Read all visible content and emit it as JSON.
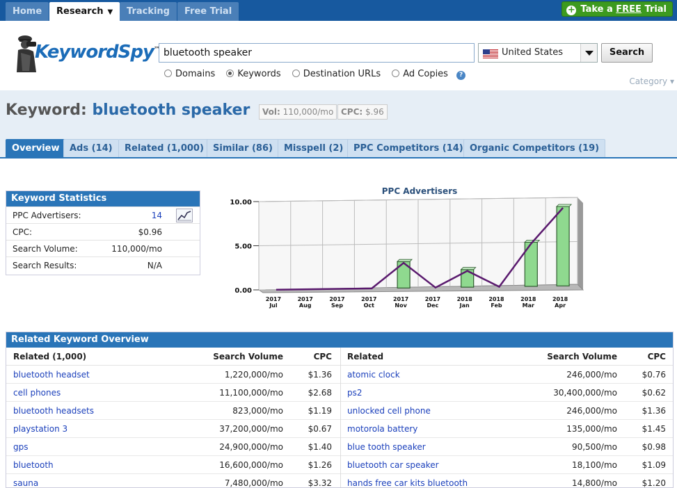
{
  "nav": {
    "tabs": [
      {
        "label": "Home"
      },
      {
        "label": "Research"
      },
      {
        "label": "Tracking"
      },
      {
        "label": "Free Trial"
      }
    ],
    "trial_prefix": "Take a ",
    "trial_free": "FREE",
    "trial_suffix": " Trial"
  },
  "logo": {
    "keyword": "Keyword",
    "spy": "Spy",
    "tm": "™"
  },
  "search": {
    "value": "bluetooth speaker",
    "country": "United States",
    "button": "Search",
    "options": [
      {
        "label": "Domains",
        "checked": false
      },
      {
        "label": "Keywords",
        "checked": true
      },
      {
        "label": "Destination URLs",
        "checked": false
      },
      {
        "label": "Ad Copies",
        "checked": false
      }
    ],
    "help": "?",
    "category": "Category"
  },
  "keyword": {
    "prefix": "Keyword:",
    "term": "bluetooth speaker",
    "vol_label": "Vol:",
    "vol": "110,000/mo",
    "cpc_label": "CPC:",
    "cpc": "$.96"
  },
  "tabs": [
    {
      "label": "Overview"
    },
    {
      "label": "Ads (14)"
    },
    {
      "label": "Related (1,000)"
    },
    {
      "label": "Similar (86)"
    },
    {
      "label": "Misspell (2)"
    },
    {
      "label": "PPC Competitors (14)"
    },
    {
      "label": "Organic Competitors (19)"
    }
  ],
  "stats": {
    "title": "Keyword Statistics",
    "rows": [
      {
        "label": "PPC Advertisers:",
        "value": "14"
      },
      {
        "label": "CPC:",
        "value": "$0.96"
      },
      {
        "label": "Search Volume:",
        "value": "110,000/mo"
      },
      {
        "label": "Search Results:",
        "value": "N/A"
      }
    ]
  },
  "chart_data": {
    "type": "bar",
    "title": "PPC Advertisers",
    "categories": [
      "2017 Jul",
      "2017 Aug",
      "2017 Sep",
      "2017 Oct",
      "2017 Nov",
      "2017 Dec",
      "2018 Jan",
      "2018 Feb",
      "2018 Mar",
      "2018 Apr"
    ],
    "category_lines": [
      [
        "2017",
        "Jul"
      ],
      [
        "2017",
        "Aug"
      ],
      [
        "2017",
        "Sep"
      ],
      [
        "2017",
        "Oct"
      ],
      [
        "2017",
        "Nov"
      ],
      [
        "2017",
        "Dec"
      ],
      [
        "2018",
        "Jan"
      ],
      [
        "2018",
        "Feb"
      ],
      [
        "2018",
        "Mar"
      ],
      [
        "2018",
        "Apr"
      ]
    ],
    "values": [
      0,
      0,
      0,
      0,
      3,
      0,
      2,
      0,
      5,
      9
    ],
    "ylim": [
      0,
      10
    ],
    "yticks": [
      "0.00",
      "5.00",
      "10.00"
    ],
    "grid": true,
    "bar_color": "#8fd98f",
    "line_color": "#5a1a6e"
  },
  "related": {
    "title": "Related Keyword Overview",
    "left_headers": [
      "Related (1,000)",
      "Search Volume",
      "CPC"
    ],
    "right_headers": [
      "Related",
      "Search Volume",
      "CPC"
    ],
    "left_rows": [
      [
        "bluetooth headset",
        "1,220,000/mo",
        "$1.36"
      ],
      [
        "cell phones",
        "11,100,000/mo",
        "$2.68"
      ],
      [
        "bluetooth headsets",
        "823,000/mo",
        "$1.19"
      ],
      [
        "playstation 3",
        "37,200,000/mo",
        "$0.67"
      ],
      [
        "gps",
        "24,900,000/mo",
        "$1.40"
      ],
      [
        "bluetooth",
        "16,600,000/mo",
        "$1.26"
      ],
      [
        "sauna",
        "7,480,000/mo",
        "$3.32"
      ]
    ],
    "right_rows": [
      [
        "atomic clock",
        "246,000/mo",
        "$0.76"
      ],
      [
        "ps2",
        "30,400,000/mo",
        "$0.62"
      ],
      [
        "unlocked cell phone",
        "246,000/mo",
        "$1.36"
      ],
      [
        "motorola battery",
        "135,000/mo",
        "$1.45"
      ],
      [
        "blue tooth speaker",
        "90,500/mo",
        "$0.98"
      ],
      [
        "bluetooth car speaker",
        "18,100/mo",
        "$1.09"
      ],
      [
        "hands free car kits bluetooth",
        "14,800/mo",
        "$1.20"
      ]
    ]
  }
}
